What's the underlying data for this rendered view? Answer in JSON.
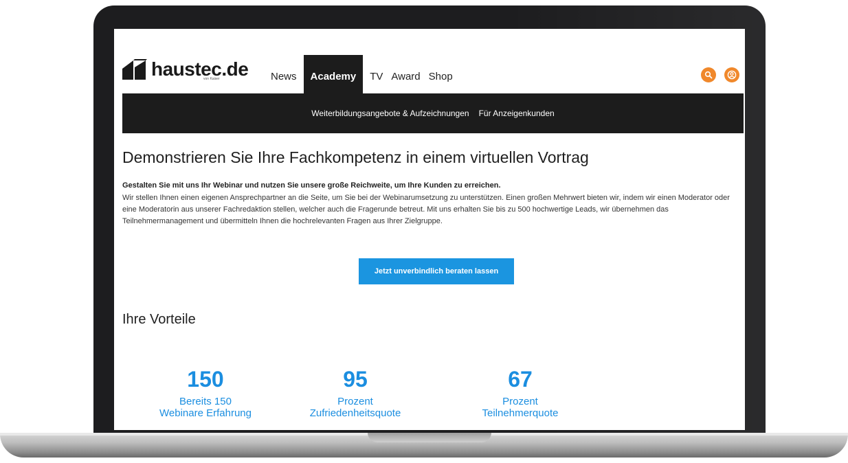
{
  "header": {
    "logo_text": "haustec.de",
    "logo_sub": "von Kaiser",
    "nav": [
      {
        "label": "News",
        "active": false
      },
      {
        "label": "Academy",
        "active": true
      },
      {
        "label": "TV",
        "active": false
      },
      {
        "label": "Award",
        "active": false
      },
      {
        "label": "Shop",
        "active": false
      }
    ],
    "icons": [
      "search-icon",
      "user-icon"
    ],
    "accent_color": "#f0882b"
  },
  "subnav": {
    "items": [
      "Weiterbildungsangebote & Aufzeichnungen",
      "Für Anzeigenkunden"
    ]
  },
  "main": {
    "title": "Demonstrieren Sie Ihre Fachkompetenz in einem virtuellen Vortrag",
    "lead_bold": "Gestalten Sie mit uns Ihr Webinar und nutzen Sie unsere große Reichweite, um Ihre Kunden zu erreichen.",
    "lead_text": "Wir stellen Ihnen einen eigenen Ansprechpartner an die Seite, um Sie bei der Webinarumsetzung zu unterstützen. Einen großen Mehrwert bieten wir, indem wir einen Moderator oder eine Moderatorin aus unserer Fachredaktion stellen, welcher auch die Fragerunde betreut. Mit uns erhalten Sie bis zu 500 hochwertige Leads, wir übernehmen das Teilnehmermanagement und übermitteln Ihnen die hochrelevanten Fragen aus Ihrer Zielgruppe.",
    "cta_label": "Jetzt unverbindlich beraten lassen",
    "cta_color": "#1b95e0",
    "section_title": "Ihre Vorteile",
    "stats": [
      {
        "number": "150",
        "label_line1": "Bereits 150",
        "label_line2": "Webinare Erfahrung"
      },
      {
        "number": "95",
        "label_line1": "Prozent",
        "label_line2": "Zufriedenheitsquote"
      },
      {
        "number": "67",
        "label_line1": "Prozent",
        "label_line2": "Teilnehmerquote"
      }
    ],
    "stat_color": "#1b8ee0"
  }
}
